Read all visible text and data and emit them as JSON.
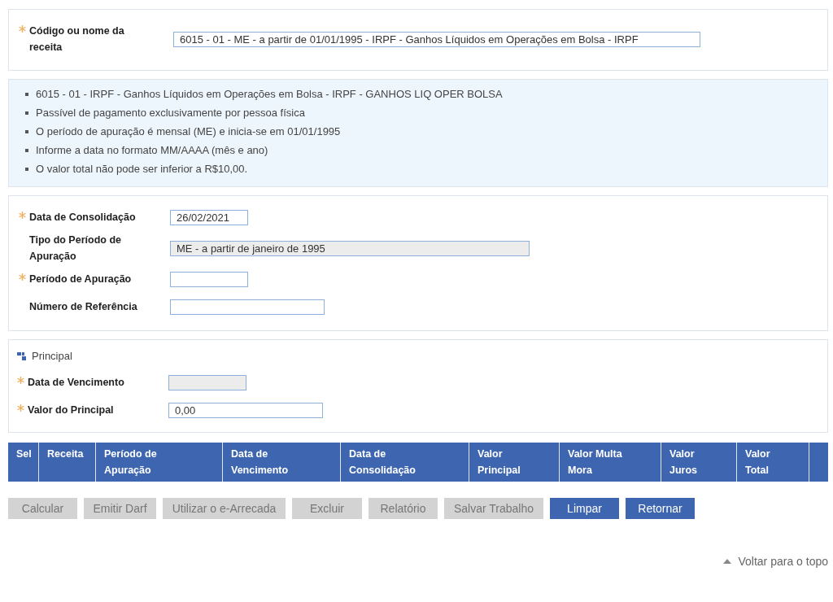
{
  "receita": {
    "label": "Código ou nome da receita",
    "required": true,
    "value": "6015 - 01 - ME - a partir de 01/01/1995 - IRPF - Ganhos Líquidos em Operações em Bolsa - IRPF"
  },
  "info": [
    "6015 - 01 - IRPF - Ganhos Líquidos em Operações em Bolsa - IRPF - GANHOS LIQ OPER BOLSA",
    "Passível de pagamento exclusivamente por pessoa física",
    "O período de apuração é mensal (ME) e inicia-se em 01/01/1995",
    "Informe a data no formato MM/AAAA (mês e ano)",
    "O valor total não pode ser inferior a R$10,00."
  ],
  "periodo_fields": [
    {
      "label": "Data de Consolidação",
      "required": true,
      "value": "26/02/2021",
      "disabled": false
    },
    {
      "label": "Tipo do Período de Apuração",
      "required": false,
      "value": "ME - a partir de janeiro de 1995",
      "disabled": true
    },
    {
      "label": "Período de Apuração",
      "required": true,
      "disabled": false
    },
    {
      "label": "Número de Referência",
      "required": false,
      "disabled": false
    }
  ],
  "principal": {
    "title": "Principal",
    "fields": [
      {
        "label": "Data de Vencimento",
        "required": true,
        "disabled": true
      },
      {
        "label": "Valor do Principal",
        "required": true,
        "value": "0,00",
        "disabled": false
      }
    ]
  },
  "table": {
    "columns": [
      "Sel",
      "Receita",
      "Período de\nApuração",
      "Data de\nVencimento",
      "Data de\nConsolidação",
      "Valor\nPrincipal",
      "Valor Multa\nMora",
      "Valor\nJuros",
      "Valor\nTotal"
    ]
  },
  "buttons": [
    {
      "label": "Calcular",
      "disabled": true
    },
    {
      "label": "Emitir Darf",
      "disabled": true
    },
    {
      "label": "Utilizar o e-Arrecada",
      "disabled": true
    },
    {
      "label": "Excluir",
      "disabled": true
    },
    {
      "label": "Relatório",
      "disabled": true
    },
    {
      "label": "Salvar Trabalho",
      "disabled": true
    },
    {
      "label": "Limpar",
      "disabled": false
    },
    {
      "label": "Retornar",
      "disabled": false
    }
  ],
  "back_to_top": "Voltar para o topo"
}
